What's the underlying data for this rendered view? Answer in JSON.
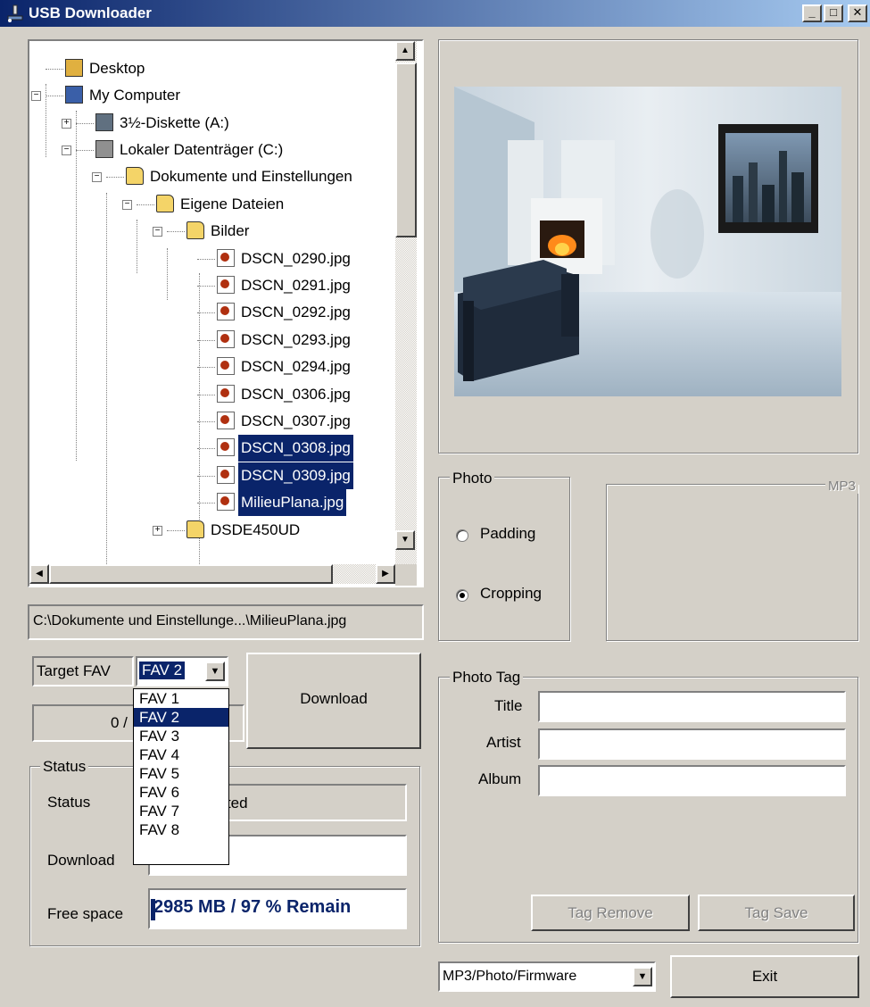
{
  "window": {
    "title": "USB Downloader",
    "minimize_glyph": "_",
    "maximize_glyph": "□",
    "close_glyph": "✕"
  },
  "tree": {
    "items": [
      {
        "label": "Desktop",
        "icon": "desktop-icon"
      },
      {
        "label": "My Computer",
        "icon": "computer-icon"
      },
      {
        "label": "3½-Diskette (A:)",
        "icon": "floppy-icon"
      },
      {
        "label": "Lokaler Datenträger (C:)",
        "icon": "drive-icon"
      },
      {
        "label": "Dokumente und Einstellungen",
        "icon": "folder-icon"
      },
      {
        "label": "Eigene Dateien",
        "icon": "folder-icon"
      },
      {
        "label": "Bilder",
        "icon": "pictures-folder-icon"
      },
      {
        "label": "DSCN_0290.jpg",
        "icon": "image-file-icon"
      },
      {
        "label": "DSCN_0291.jpg",
        "icon": "image-file-icon"
      },
      {
        "label": "DSCN_0292.jpg",
        "icon": "image-file-icon"
      },
      {
        "label": "DSCN_0293.jpg",
        "icon": "image-file-icon"
      },
      {
        "label": "DSCN_0294.jpg",
        "icon": "image-file-icon"
      },
      {
        "label": "DSCN_0306.jpg",
        "icon": "image-file-icon"
      },
      {
        "label": "DSCN_0307.jpg",
        "icon": "image-file-icon"
      },
      {
        "label": "DSCN_0308.jpg",
        "icon": "image-file-icon"
      },
      {
        "label": "DSCN_0309.jpg",
        "icon": "image-file-icon"
      },
      {
        "label": "MilieuPlana.jpg",
        "icon": "image-file-icon"
      },
      {
        "label": "DSDE450UD",
        "icon": "folder-icon"
      }
    ],
    "selected": [
      "DSCN_0308.jpg",
      "DSCN_0309.jpg",
      "MilieuPlana.jpg"
    ]
  },
  "path": {
    "value": "C:\\Dokumente und Einstellunge...\\MilieuPlana.jpg"
  },
  "target": {
    "label": "Target FAV",
    "selected": "FAV 2",
    "options": [
      "FAV 1",
      "FAV 2",
      "FAV 3",
      "FAV 4",
      "FAV 5",
      "FAV 6",
      "FAV 7",
      "FAV 8"
    ]
  },
  "progress_text": "0 /",
  "download_button": "Download",
  "status_group": {
    "legend": "Status",
    "status_label": "Status",
    "status_value": "ected",
    "download_label": "Download",
    "download_value": "",
    "free_label": "Free space",
    "free_value": "2985 MB / 97 % Remain"
  },
  "photo_group": {
    "legend": "Photo",
    "padding": "Padding",
    "cropping": "Cropping",
    "selected": "Cropping"
  },
  "mp3_group": {
    "legend": "MP3"
  },
  "tag_group": {
    "legend": "Photo Tag",
    "title_label": "Title",
    "artist_label": "Artist",
    "album_label": "Album",
    "title_value": "",
    "artist_value": "",
    "album_value": "",
    "remove": "Tag Remove",
    "save": "Tag Save"
  },
  "mode": {
    "selected": "MP3/Photo/Firmware"
  },
  "exit_button": "Exit",
  "colors": {
    "window_bg": "#d4d0c8",
    "selection": "#0a246a",
    "titlebar_start": "#0a246a",
    "titlebar_end": "#a6caf0"
  }
}
